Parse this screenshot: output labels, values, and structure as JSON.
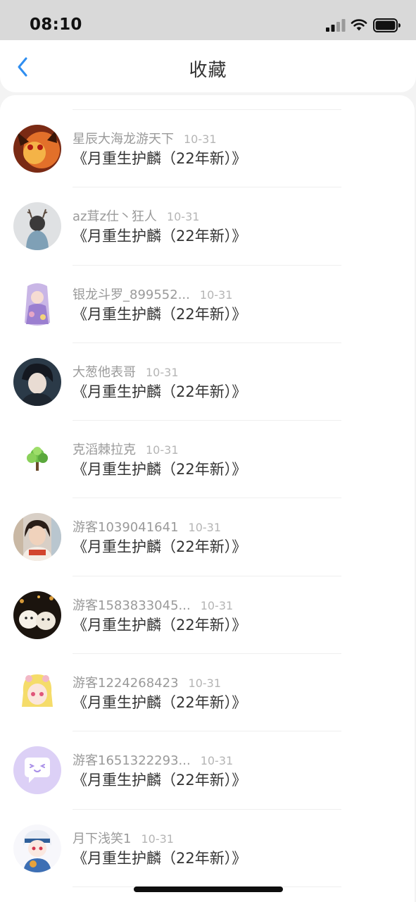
{
  "status_bar": {
    "time": "08:10"
  },
  "header": {
    "title": "收藏",
    "back_icon": "chevron-left-icon"
  },
  "favorites": [
    {
      "user": "星辰大海龙游天下",
      "date": "10-31",
      "title": "《月重生护麟（22年新）》"
    },
    {
      "user": "az茸z仕丶狂人",
      "date": "10-31",
      "title": "《月重生护麟（22年新）》"
    },
    {
      "user": "银龙斗罗_899552...",
      "date": "10-31",
      "title": "《月重生护麟（22年新）》"
    },
    {
      "user": "大葱他表哥",
      "date": "10-31",
      "title": "《月重生护麟（22年新）》"
    },
    {
      "user": "克滔棘拉克",
      "date": "10-31",
      "title": "《月重生护麟（22年新）》"
    },
    {
      "user": "游客1039041641",
      "date": "10-31",
      "title": "《月重生护麟（22年新）》"
    },
    {
      "user": "游客1583833045...",
      "date": "10-31",
      "title": "《月重生护麟（22年新）》"
    },
    {
      "user": "游客1224268423",
      "date": "10-31",
      "title": "《月重生护麟（22年新）》"
    },
    {
      "user": "游客1651322293...",
      "date": "10-31",
      "title": "《月重生护麟（22年新）》"
    },
    {
      "user": "月下浅笑1",
      "date": "10-31",
      "title": "《月重生护麟（22年新）》"
    }
  ],
  "colors": {
    "accent": "#2f8ef0",
    "status_bar_bg": "#d9d9d9",
    "page_bg": "#f3f3f3"
  }
}
